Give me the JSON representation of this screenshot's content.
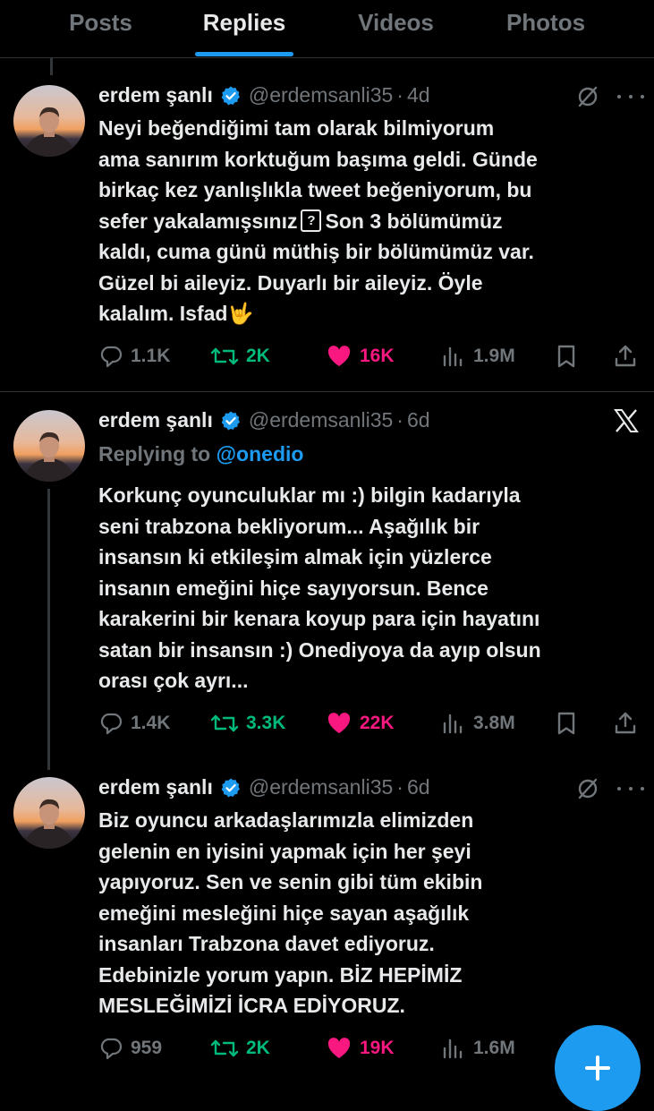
{
  "tabs": [
    {
      "label": "Posts"
    },
    {
      "label": "Replies"
    },
    {
      "label": "Videos"
    },
    {
      "label": "Photos"
    }
  ],
  "accent_color": "#1d9bf0",
  "tweets": [
    {
      "name": "erdem şanlı",
      "handle": "@erdemsanli35",
      "time": "4d",
      "header_icon": "slash-circle-icon",
      "lines": [
        "Neyi beğendiğimi tam olarak bilmiyorum",
        "ama sanırım korktuğum başıma geldi. Günde",
        "birkaç kez yanlışlıkla tweet beğeniyorum, bu",
        "sefer yakalamışsınız",
        "Son 3 bölümümüz",
        "kaldı, cuma günü müthiş bir bölümümüz var.",
        "Güzel bi aileyiz. Duyarlı bir aileyiz. Öyle",
        "kalalım. Isfad"
      ],
      "placeholder_glyph": "?",
      "emoji": "🤟",
      "stats": {
        "replies": "1.1K",
        "reposts": "2K",
        "likes": "16K",
        "views": "1.9M"
      }
    },
    {
      "name": "erdem şanlı",
      "handle": "@erdemsanli35",
      "time": "6d",
      "header_icon": "x-logo-icon",
      "replying_prefix": "Replying to",
      "replying_to": "@onedio",
      "lines": [
        "Korkunç oyunculuklar mı :) bilgin kadarıyla",
        "seni trabzona bekliyorum... Aşağılık bir",
        "insansın ki etkileşim almak için yüzlerce",
        "insanın emeğini hiçe sayıyorsun. Bence",
        "karakerini bir kenara koyup para için hayatını",
        "satan bir insansın :) Onediyoya da ayıp olsun",
        "orası çok ayrı..."
      ],
      "stats": {
        "replies": "1.4K",
        "reposts": "3.3K",
        "likes": "22K",
        "views": "3.8M"
      }
    },
    {
      "name": "erdem şanlı",
      "handle": "@erdemsanli35",
      "time": "6d",
      "header_icon": "slash-circle-icon",
      "lines": [
        "Biz oyuncu arkadaşlarımızla elimizden",
        "gelenin en iyisini yapmak için her şeyi",
        "yapıyoruz. Sen ve senin gibi tüm ekibin",
        "emeğini mesleğini hiçe sayan aşağılık",
        "insanları Trabzona davet ediyoruz.",
        "Edebinizle yorum yapın. BİZ HEPİMİZ",
        "MESLEĞİMİZİ İCRA EDİYORUZ."
      ],
      "stats": {
        "replies": "959",
        "reposts": "2K",
        "likes": "19K",
        "views": "1.6M"
      }
    }
  ],
  "fab_icon": "plus-icon"
}
